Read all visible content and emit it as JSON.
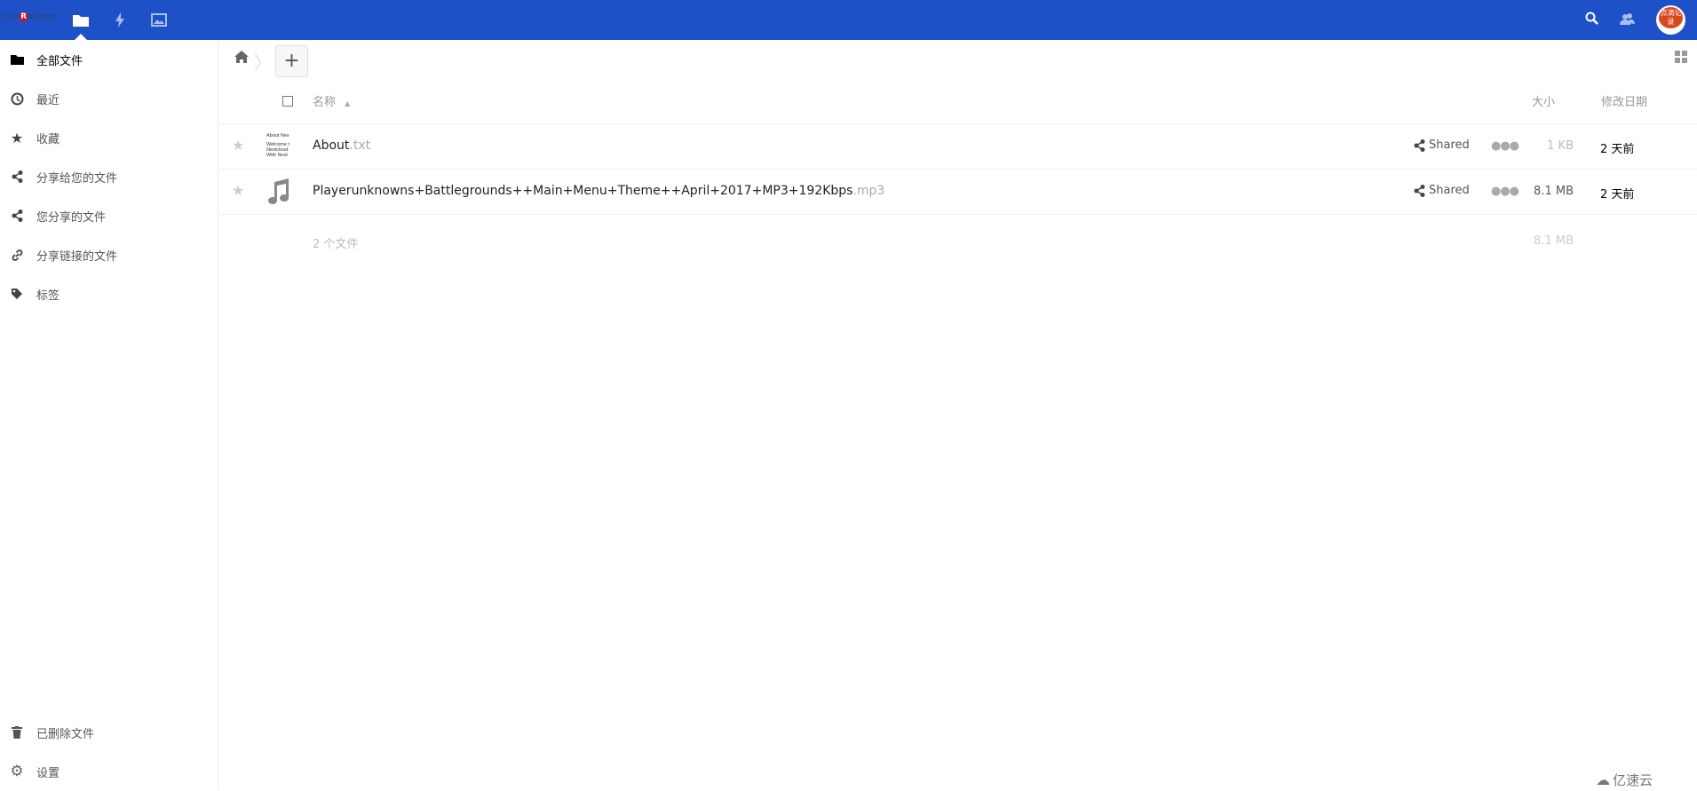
{
  "header": {
    "logo": "CoolRatings",
    "logo_mark": "R",
    "apps": [
      "files-icon",
      "activity-icon",
      "gallery-icon"
    ],
    "accent": "#1e50c8",
    "avatar_text": "点滴记录"
  },
  "sidebar": {
    "items": [
      {
        "label": "全部文件",
        "icon": "folder-icon"
      },
      {
        "label": "最近",
        "icon": "clock-icon"
      },
      {
        "label": "收藏",
        "icon": "star-icon"
      },
      {
        "label": "分享给您的文件",
        "icon": "share-icon"
      },
      {
        "label": "您分享的文件",
        "icon": "share-icon"
      },
      {
        "label": "分享链接的文件",
        "icon": "link-icon"
      },
      {
        "label": "标签",
        "icon": "tag-icon"
      }
    ],
    "bottom": [
      {
        "label": "已删除文件",
        "icon": "trash-icon"
      },
      {
        "label": "设置",
        "icon": "gear-icon"
      }
    ]
  },
  "toolbar": {
    "add_label": "+"
  },
  "table": {
    "headers": {
      "name": "名称",
      "size": "大小",
      "modified": "修改日期"
    },
    "rows": [
      {
        "name": "About",
        "ext": ".txt",
        "share": "Shared",
        "size": "1 KB",
        "modified": "2 天前",
        "thumb": [
          "About Nex",
          "Welcome t",
          "Nextcloud",
          "With Next"
        ]
      },
      {
        "name": "Playerunknowns+Battlegrounds++Main+Menu+Theme++April+2017+MP3+192Kbps",
        "ext": ".mp3",
        "share": "Shared",
        "size": "8.1 MB",
        "modified": "2 天前"
      }
    ],
    "summary": {
      "count": "2 个文件",
      "size": "8.1 MB"
    }
  },
  "watermark": "亿速云"
}
